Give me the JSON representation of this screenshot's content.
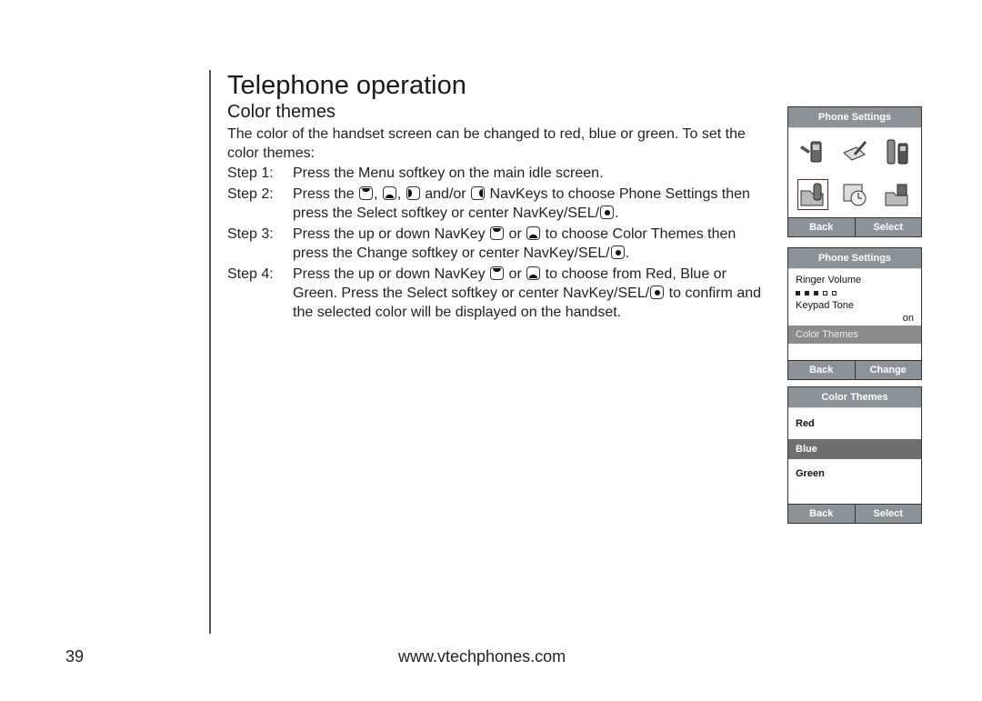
{
  "page": {
    "title": "Telephone operation",
    "section": "Color themes",
    "intro": "The color of the handset screen can be changed to red, blue or green. To set the color themes:",
    "steps": [
      {
        "label": "Step 1:",
        "parts": [
          "Press the Menu softkey on the main idle screen."
        ]
      },
      {
        "label": "Step 2:",
        "parts": [
          "Press the ",
          ", ",
          ", ",
          " and/or ",
          " NavKeys to choose Phone Settings then press the Select softkey or center NavKey/SEL/",
          "."
        ]
      },
      {
        "label": "Step 3:",
        "parts": [
          "Press the up or down NavKey ",
          " or ",
          " to choose Color Themes then press the Change softkey or center NavKey/SEL/",
          "."
        ]
      },
      {
        "label": "Step 4:",
        "parts": [
          "Press the up or down NavKey ",
          " or ",
          " to choose from Red, Blue or Green. Press the Select softkey or center NavKey/SEL/",
          " to confirm and the selected color will be displayed on the handset."
        ]
      }
    ],
    "page_number": "39",
    "url": "www.vtechphones.com"
  },
  "screens": {
    "menu": {
      "header": "Phone Settings",
      "icons": [
        "handset-settings-icon",
        "notepad-pen-icon",
        "intercom-handsets-icon",
        "folder-handset-icon",
        "calendar-clock-icon",
        "folder-photo-icon"
      ],
      "selected_index": 3,
      "softkeys": [
        "Back",
        "Select"
      ]
    },
    "settings": {
      "header": "Phone Settings",
      "items": [
        {
          "label": "Ringer Volume",
          "level_filled": 3,
          "level_total": 5
        },
        {
          "label": "Keypad Tone",
          "value": "on"
        },
        {
          "label": "Color Themes",
          "highlighted": true
        }
      ],
      "softkeys": [
        "Back",
        "Change"
      ]
    },
    "themes": {
      "header": "Color Themes",
      "options": [
        "Red",
        "Blue",
        "Green"
      ],
      "selected": "Blue",
      "softkeys": [
        "Back",
        "Select"
      ]
    }
  },
  "colors": {
    "screen_header": "#8b9298",
    "highlight": "#6e6e6e"
  }
}
